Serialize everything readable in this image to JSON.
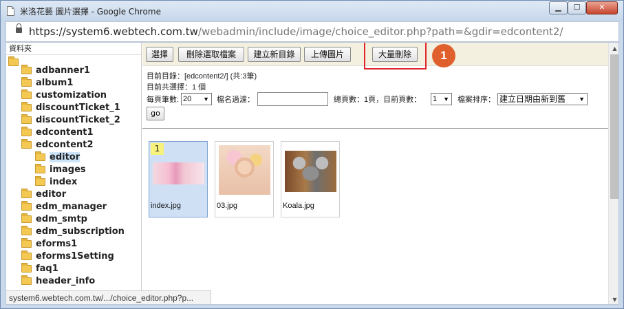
{
  "window": {
    "title": "米洛花藝 圖片選擇 - Google Chrome",
    "min_glyph": "▁",
    "max_glyph": "☐",
    "close_glyph": "✕"
  },
  "address": {
    "host": "https://system6.webtech.com.tw",
    "path": "/webadmin/include/image/choice_editor.php?path=&gdir=edcontent2/"
  },
  "sidebar": {
    "header": "資料夾",
    "items": [
      {
        "label": "adbanner1"
      },
      {
        "label": "album1"
      },
      {
        "label": "customization"
      },
      {
        "label": "discountTicket_1"
      },
      {
        "label": "discountTicket_2"
      },
      {
        "label": "edcontent1"
      },
      {
        "label": "edcontent2"
      },
      {
        "label": "editor"
      },
      {
        "label": "images"
      },
      {
        "label": "index"
      },
      {
        "label": "editor"
      },
      {
        "label": "edm_manager"
      },
      {
        "label": "edm_smtp"
      },
      {
        "label": "edm_subscription"
      },
      {
        "label": "eforms1"
      },
      {
        "label": "eforms1Setting"
      },
      {
        "label": "faq1"
      },
      {
        "label": "header_info"
      }
    ]
  },
  "toolbar": {
    "select": "選擇",
    "delete_selected": "刪除選取檔案",
    "new_dir": "建立新目錄",
    "upload": "上傳圖片",
    "bulk_delete": "大量刪除"
  },
  "callout": {
    "step": "1",
    "color": "#e0602d",
    "box_color": "#e0262b"
  },
  "info": {
    "current_dir": "目前目錄：[edcontent2/] (共:3筆)",
    "selected": "目前共選擇：1 個"
  },
  "filters": {
    "per_page_label": "每頁筆數:",
    "per_page_value": "20",
    "name_filter_label": "檔名過濾：",
    "total_pages": "總頁數：1頁，目前頁數：",
    "current_page": "1",
    "sort_label": "檔案排序：",
    "sort_value": "建立日期由新到舊",
    "go": "go"
  },
  "files": [
    {
      "name": "index.jpg",
      "selected": true,
      "badge": "1"
    },
    {
      "name": "03.jpg",
      "selected": false
    },
    {
      "name": "Koala.jpg",
      "selected": false
    }
  ],
  "status_url": "system6.webtech.com.tw/.../choice_editor.php?p..."
}
